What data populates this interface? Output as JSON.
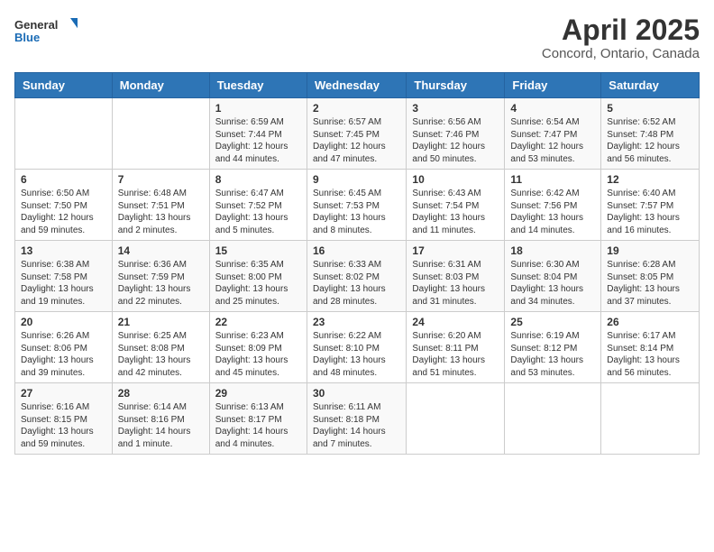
{
  "header": {
    "logo_general": "General",
    "logo_blue": "Blue",
    "title": "April 2025",
    "subtitle": "Concord, Ontario, Canada"
  },
  "weekdays": [
    "Sunday",
    "Monday",
    "Tuesday",
    "Wednesday",
    "Thursday",
    "Friday",
    "Saturday"
  ],
  "weeks": [
    [
      {
        "day": "",
        "info": ""
      },
      {
        "day": "",
        "info": ""
      },
      {
        "day": "1",
        "info": "Sunrise: 6:59 AM\nSunset: 7:44 PM\nDaylight: 12 hours and 44 minutes."
      },
      {
        "day": "2",
        "info": "Sunrise: 6:57 AM\nSunset: 7:45 PM\nDaylight: 12 hours and 47 minutes."
      },
      {
        "day": "3",
        "info": "Sunrise: 6:56 AM\nSunset: 7:46 PM\nDaylight: 12 hours and 50 minutes."
      },
      {
        "day": "4",
        "info": "Sunrise: 6:54 AM\nSunset: 7:47 PM\nDaylight: 12 hours and 53 minutes."
      },
      {
        "day": "5",
        "info": "Sunrise: 6:52 AM\nSunset: 7:48 PM\nDaylight: 12 hours and 56 minutes."
      }
    ],
    [
      {
        "day": "6",
        "info": "Sunrise: 6:50 AM\nSunset: 7:50 PM\nDaylight: 12 hours and 59 minutes."
      },
      {
        "day": "7",
        "info": "Sunrise: 6:48 AM\nSunset: 7:51 PM\nDaylight: 13 hours and 2 minutes."
      },
      {
        "day": "8",
        "info": "Sunrise: 6:47 AM\nSunset: 7:52 PM\nDaylight: 13 hours and 5 minutes."
      },
      {
        "day": "9",
        "info": "Sunrise: 6:45 AM\nSunset: 7:53 PM\nDaylight: 13 hours and 8 minutes."
      },
      {
        "day": "10",
        "info": "Sunrise: 6:43 AM\nSunset: 7:54 PM\nDaylight: 13 hours and 11 minutes."
      },
      {
        "day": "11",
        "info": "Sunrise: 6:42 AM\nSunset: 7:56 PM\nDaylight: 13 hours and 14 minutes."
      },
      {
        "day": "12",
        "info": "Sunrise: 6:40 AM\nSunset: 7:57 PM\nDaylight: 13 hours and 16 minutes."
      }
    ],
    [
      {
        "day": "13",
        "info": "Sunrise: 6:38 AM\nSunset: 7:58 PM\nDaylight: 13 hours and 19 minutes."
      },
      {
        "day": "14",
        "info": "Sunrise: 6:36 AM\nSunset: 7:59 PM\nDaylight: 13 hours and 22 minutes."
      },
      {
        "day": "15",
        "info": "Sunrise: 6:35 AM\nSunset: 8:00 PM\nDaylight: 13 hours and 25 minutes."
      },
      {
        "day": "16",
        "info": "Sunrise: 6:33 AM\nSunset: 8:02 PM\nDaylight: 13 hours and 28 minutes."
      },
      {
        "day": "17",
        "info": "Sunrise: 6:31 AM\nSunset: 8:03 PM\nDaylight: 13 hours and 31 minutes."
      },
      {
        "day": "18",
        "info": "Sunrise: 6:30 AM\nSunset: 8:04 PM\nDaylight: 13 hours and 34 minutes."
      },
      {
        "day": "19",
        "info": "Sunrise: 6:28 AM\nSunset: 8:05 PM\nDaylight: 13 hours and 37 minutes."
      }
    ],
    [
      {
        "day": "20",
        "info": "Sunrise: 6:26 AM\nSunset: 8:06 PM\nDaylight: 13 hours and 39 minutes."
      },
      {
        "day": "21",
        "info": "Sunrise: 6:25 AM\nSunset: 8:08 PM\nDaylight: 13 hours and 42 minutes."
      },
      {
        "day": "22",
        "info": "Sunrise: 6:23 AM\nSunset: 8:09 PM\nDaylight: 13 hours and 45 minutes."
      },
      {
        "day": "23",
        "info": "Sunrise: 6:22 AM\nSunset: 8:10 PM\nDaylight: 13 hours and 48 minutes."
      },
      {
        "day": "24",
        "info": "Sunrise: 6:20 AM\nSunset: 8:11 PM\nDaylight: 13 hours and 51 minutes."
      },
      {
        "day": "25",
        "info": "Sunrise: 6:19 AM\nSunset: 8:12 PM\nDaylight: 13 hours and 53 minutes."
      },
      {
        "day": "26",
        "info": "Sunrise: 6:17 AM\nSunset: 8:14 PM\nDaylight: 13 hours and 56 minutes."
      }
    ],
    [
      {
        "day": "27",
        "info": "Sunrise: 6:16 AM\nSunset: 8:15 PM\nDaylight: 13 hours and 59 minutes."
      },
      {
        "day": "28",
        "info": "Sunrise: 6:14 AM\nSunset: 8:16 PM\nDaylight: 14 hours and 1 minute."
      },
      {
        "day": "29",
        "info": "Sunrise: 6:13 AM\nSunset: 8:17 PM\nDaylight: 14 hours and 4 minutes."
      },
      {
        "day": "30",
        "info": "Sunrise: 6:11 AM\nSunset: 8:18 PM\nDaylight: 14 hours and 7 minutes."
      },
      {
        "day": "",
        "info": ""
      },
      {
        "day": "",
        "info": ""
      },
      {
        "day": "",
        "info": ""
      }
    ]
  ]
}
